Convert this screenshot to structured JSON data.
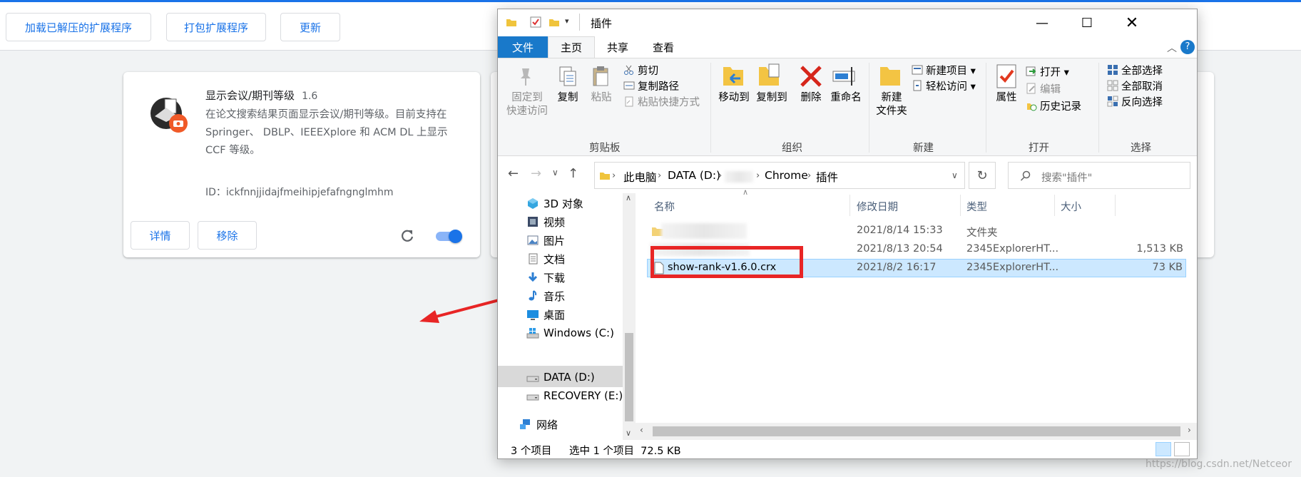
{
  "chrome": {
    "buttons": {
      "load_unpacked": "加载已解压的扩展程序",
      "pack_extension": "打包扩展程序",
      "update": "更新"
    },
    "extension": {
      "name": "显示会议/期刊等级",
      "version": "1.6",
      "description": "在论文搜索结果页面显示会议/期刊等级。目前支持在 Springer、 DBLP、IEEEXplore 和 ACM DL 上显示 CCF 等级。",
      "id_text": "ID：ickfnnjjidajfmeihipjefafngnglmhm",
      "details_label": "详情",
      "remove_label": "移除",
      "enabled": true
    }
  },
  "explorer": {
    "title": "插件",
    "tabs": {
      "file": "文件",
      "home": "主页",
      "share": "共享",
      "view": "查看"
    },
    "ribbon": {
      "clipboard": {
        "group": "剪贴板",
        "pin": "固定到\n快速访问",
        "copy": "复制",
        "paste": "粘贴",
        "cut": "剪切",
        "copy_path": "复制路径",
        "paste_shortcut": "粘贴快捷方式"
      },
      "organize": {
        "group": "组织",
        "move_to": "移动到",
        "copy_to": "复制到",
        "delete": "删除",
        "rename": "重命名"
      },
      "new": {
        "group": "新建",
        "new_folder": "新建\n文件夹",
        "new_item": "新建项目",
        "easy_access": "轻松访问"
      },
      "open": {
        "group": "打开",
        "properties": "属性",
        "open": "打开",
        "edit": "编辑",
        "history": "历史记录"
      },
      "select": {
        "group": "选择",
        "select_all": "全部选择",
        "select_none": "全部取消",
        "invert": "反向选择"
      }
    },
    "address": {
      "crumbs": [
        "此电脑",
        "DATA (D:)",
        "Chrome",
        "插件"
      ],
      "search_placeholder": "搜索\"插件\""
    },
    "nav": [
      {
        "label": "3D 对象",
        "icon": "cube-icon"
      },
      {
        "label": "视频",
        "icon": "video-icon"
      },
      {
        "label": "图片",
        "icon": "pictures-icon"
      },
      {
        "label": "文档",
        "icon": "documents-icon"
      },
      {
        "label": "下载",
        "icon": "download-icon"
      },
      {
        "label": "音乐",
        "icon": "music-icon"
      },
      {
        "label": "桌面",
        "icon": "desktop-icon"
      },
      {
        "label": "Windows (C:)",
        "icon": "drive-icon"
      },
      {
        "label": "DATA (D:)",
        "icon": "drive-icon"
      },
      {
        "label": "RECOVERY (E:)",
        "icon": "drive-icon"
      },
      {
        "label": "网络",
        "icon": "network-icon"
      }
    ],
    "columns": {
      "name": "名称",
      "modified": "修改日期",
      "type": "类型",
      "size": "大小"
    },
    "files": [
      {
        "name": "",
        "modified": "2021/8/14 15:33",
        "type": "文件夹",
        "size": ""
      },
      {
        "name": "",
        "modified": "2021/8/13 20:54",
        "type": "2345ExplorerHT...",
        "size": "1,513 KB"
      },
      {
        "name": "show-rank-v1.6.0.crx",
        "modified": "2021/8/2 16:17",
        "type": "2345ExplorerHT...",
        "size": "73 KB"
      }
    ],
    "status": {
      "count": "3 个项目",
      "selected": "选中 1 个项目  72.5 KB"
    }
  },
  "watermark": "https://blog.csdn.net/Netceor",
  "colors": {
    "accent": "#1a73e8",
    "file_tab": "#1979ca",
    "highlight": "#e82525",
    "selection": "#cce8ff"
  }
}
